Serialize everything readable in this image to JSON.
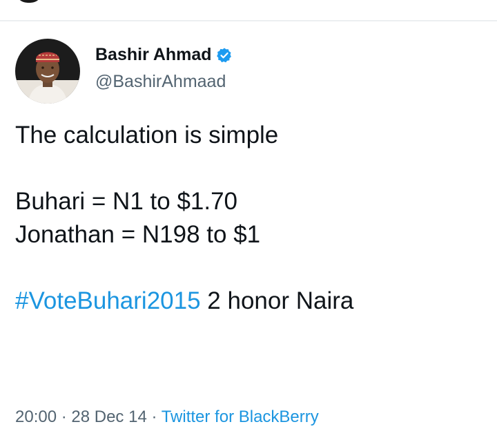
{
  "tweet": {
    "author": {
      "display_name": "Bashir Ahmad",
      "handle": "@BashirAhmaad",
      "verified": true,
      "avatar_icon": "profile-photo"
    },
    "text_lines": {
      "line1": "The calculation is simple",
      "line2": "Buhari = N1 to $1.70",
      "line3": "Jonathan = N198 to $1",
      "hashtag": "#VoteBuhari2015",
      "line4_rest": " 2 honor Naira"
    },
    "time": "20:00",
    "separator": " · ",
    "date": "28 Dec 14",
    "source": "Twitter for BlackBerry"
  },
  "colors": {
    "link": "#1b95e0",
    "secondary_text": "#536471",
    "primary_text": "#0f1419",
    "verified_badge": "#1d9bf0"
  }
}
